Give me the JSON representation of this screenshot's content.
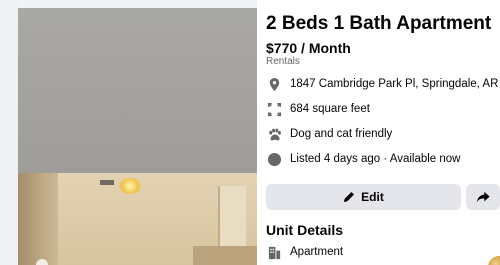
{
  "listing": {
    "title": "2 Beds 1 Bath Apartment",
    "price": "$770 / Month",
    "category": "Rentals"
  },
  "info": [
    {
      "icon": "location-pin-icon",
      "text": "1847 Cambridge Park Pl, Springdale, AR"
    },
    {
      "icon": "square-footage-icon",
      "text": "684 square feet"
    },
    {
      "icon": "paw-icon",
      "text": "Dog and cat friendly"
    },
    {
      "icon": "clock-icon",
      "text": "Listed 4 days ago · Available now"
    }
  ],
  "actions": {
    "edit_label": "Edit"
  },
  "unit_details": {
    "title": "Unit Details",
    "type_label": "Apartment"
  },
  "colors": {
    "button_bg": "#e4e6eb",
    "icon_gray": "#65676b",
    "text_primary": "#050505"
  }
}
